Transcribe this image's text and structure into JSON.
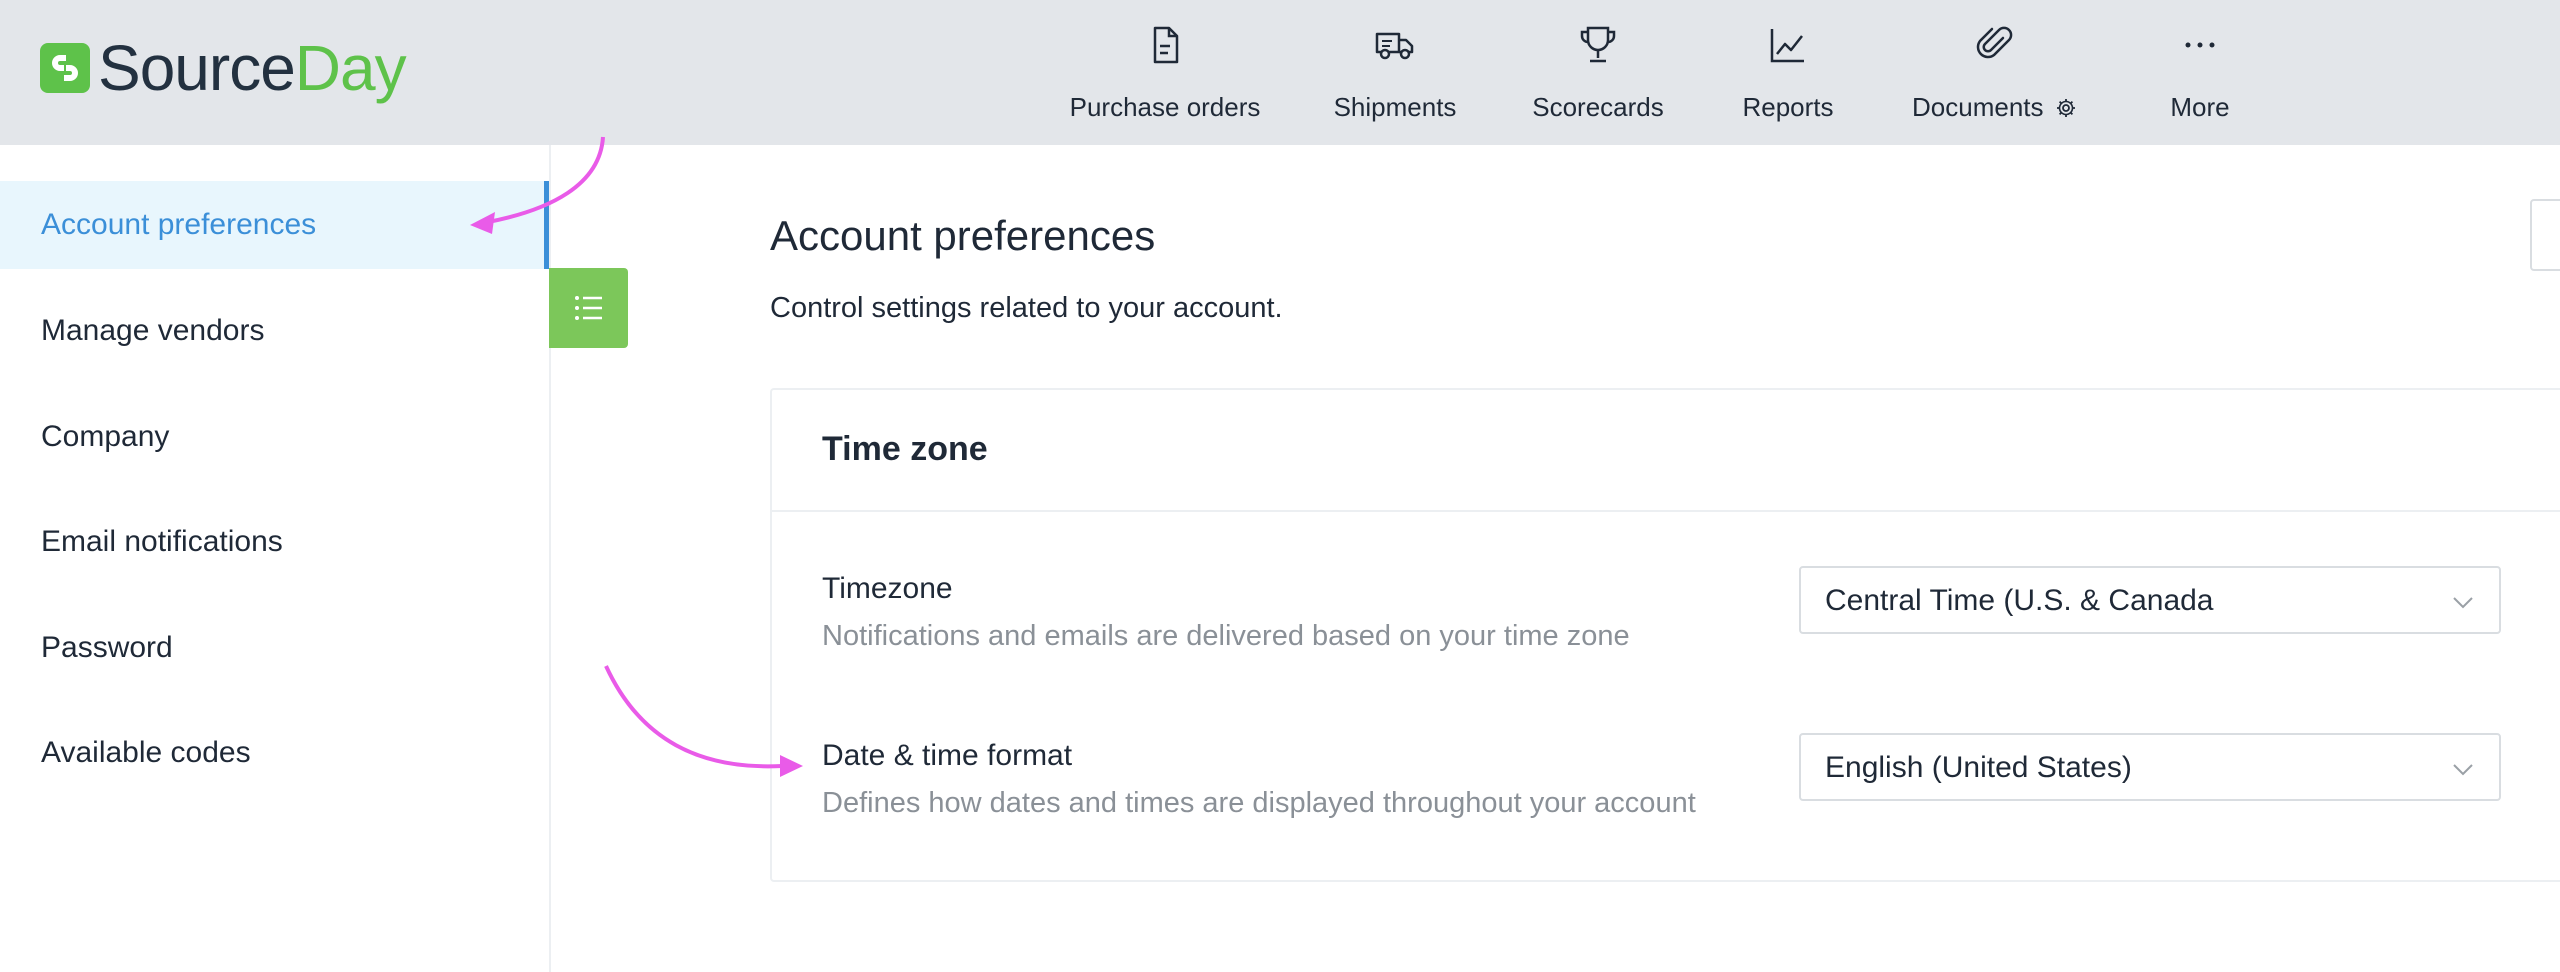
{
  "brand": {
    "part1": "Source",
    "part2": "Day",
    "color": "#5ec24a"
  },
  "nav": {
    "items": [
      {
        "label": "Purchase orders",
        "icon": "document-icon"
      },
      {
        "label": "Shipments",
        "icon": "truck-icon"
      },
      {
        "label": "Scorecards",
        "icon": "trophy-icon"
      },
      {
        "label": "Reports",
        "icon": "line-chart-icon"
      },
      {
        "label": "Documents",
        "icon": "paperclip-icon",
        "badge_icon": "gear-icon"
      },
      {
        "label": "More",
        "icon": "more-dots-icon"
      }
    ]
  },
  "sidebar": {
    "items": [
      {
        "label": "Account preferences",
        "active": true
      },
      {
        "label": "Manage vendors"
      },
      {
        "label": "Company"
      },
      {
        "label": "Email notifications"
      },
      {
        "label": "Password"
      },
      {
        "label": "Available codes"
      }
    ],
    "toggle_icon": "list-icon"
  },
  "main": {
    "title": "Account preferences",
    "subtitle": "Control settings related to your account.",
    "card": {
      "title": "Time zone",
      "fields": [
        {
          "label": "Timezone",
          "description": "Notifications and emails are delivered based on your time zone",
          "value": "Central Time (U.S. & Canada"
        },
        {
          "label": "Date & time format",
          "description": "Defines how dates and times are displayed throughout your account",
          "value": "English (United States)"
        }
      ]
    }
  },
  "colors": {
    "accent": "#3b8fd8",
    "annotation": "#e95be8",
    "header_bg": "#e3e6ea"
  }
}
